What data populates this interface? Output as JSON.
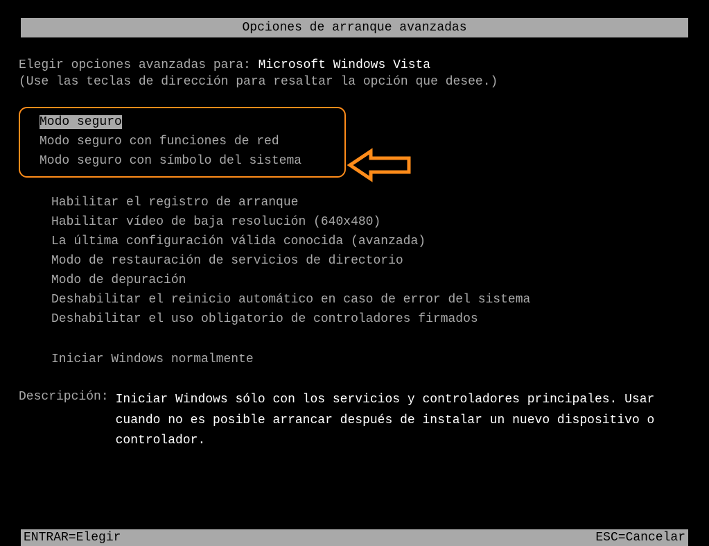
{
  "title": "Opciones de arranque avanzadas",
  "intro": {
    "prefix": "Elegir opciones avanzadas para: ",
    "os": "Microsoft Windows Vista"
  },
  "hint": "(Use las teclas de dirección para resaltar la opción que desee.)",
  "safe_mode_group": [
    {
      "label": "Modo seguro",
      "selected": true
    },
    {
      "label": "Modo seguro con funciones de red",
      "selected": false
    },
    {
      "label": "Modo seguro con símbolo del sistema",
      "selected": false
    }
  ],
  "other_options": [
    "Habilitar el registro de arranque",
    "Habilitar vídeo de baja resolución (640x480)",
    "La última configuración válida conocida (avanzada)",
    "Modo de restauración de servicios de directorio",
    "Modo de depuración",
    "Deshabilitar el reinicio automático en caso de error del sistema",
    "Deshabilitar el uso obligatorio de controladores firmados"
  ],
  "start_normal": "Iniciar Windows normalmente",
  "description": {
    "label": "Descripción:",
    "text": "Iniciar Windows sólo con los servicios y controladores principales. Usar cuando no es posible arrancar después de instalar un nuevo dispositivo o controlador."
  },
  "footer": {
    "enter": "ENTRAR=Elegir",
    "esc": "ESC=Cancelar"
  },
  "colors": {
    "highlight": "#ff8c1a",
    "light": "#a9a9a9",
    "white": "#ffffff"
  }
}
